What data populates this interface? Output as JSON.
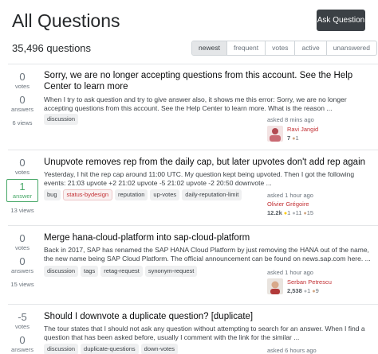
{
  "header": {
    "title": "All Questions",
    "ask_button": "Ask Question"
  },
  "question_count": "35,496 questions",
  "tabs": [
    "newest",
    "frequent",
    "votes",
    "active",
    "unanswered"
  ],
  "questions": [
    {
      "votes": "0",
      "votes_label": "votes",
      "answers": "0",
      "answers_label": "answers",
      "views": "6 views",
      "title": "Sorry, we are no longer accepting questions from this account. See the Help Center to learn more",
      "excerpt": "When I try to ask question and try to give answer also, it shows me this error: Sorry, we are no longer accepting questions from this account. See the Help Center to learn more. What is the reason ...",
      "tags": [
        "discussion"
      ],
      "asked": "asked 8 mins ago",
      "user": {
        "name": "Ravi Jangid",
        "rep": "7",
        "bronze": "1"
      }
    },
    {
      "votes": "0",
      "votes_label": "votes",
      "answers": "1",
      "answers_label": "answer",
      "views": "13 views",
      "title": "Unupvote removes rep from the daily cap, but later upvotes don't add rep again",
      "excerpt": "Yesterday, I hit the rep cap around 11:00 UTC. My question kept being upvoted. Then I got the following events: 21:03 upvote +2 21:02 upvote -5 21:02 upvote -2 20:50 downvote ...",
      "tags": [
        "bug",
        "status-bydesign",
        "reputation",
        "up-votes",
        "daily-reputation-limit"
      ],
      "asked": "asked 1 hour ago",
      "user": {
        "name": "Olivier Grégoire",
        "rep": "12.2k",
        "gold": "1",
        "silver": "11",
        "bronze": "15"
      }
    },
    {
      "votes": "0",
      "votes_label": "votes",
      "answers": "0",
      "answers_label": "answers",
      "views": "15 views",
      "title": "Merge hana-cloud-platform into sap-cloud-platform",
      "excerpt": "Back in 2017, SAP has renamed the SAP HANA Cloud Platform by just removing the HANA out of the name, the new name being SAP Cloud Platform. The official announcement can be found on news.sap.com here. ...",
      "tags": [
        "discussion",
        "tags",
        "retag-request",
        "synonym-request"
      ],
      "asked": "asked 1 hour ago",
      "user": {
        "name": "Serban Petrescu",
        "rep": "2,538",
        "silver": "1",
        "bronze": "9"
      }
    },
    {
      "votes": "-5",
      "votes_label": "votes",
      "answers": "0",
      "answers_label": "answers",
      "title": "Should I downvote a duplicate question? [duplicate]",
      "excerpt": "The tour states that I should not ask any question without attempting to search for an answer. When I find a question that has been asked before, usually I comment with the link for the similar ...",
      "tags": [
        "discussion",
        "duplicate-questions",
        "down-votes"
      ],
      "asked": "asked 6 hours ago"
    }
  ],
  "colors": {
    "accent_dark": "#3b4045",
    "link": "#0c0d0e",
    "tag_bg": "#e1ecf4",
    "tag_text": "#39739d",
    "answered": "#48a868",
    "user": "#c22e32"
  }
}
